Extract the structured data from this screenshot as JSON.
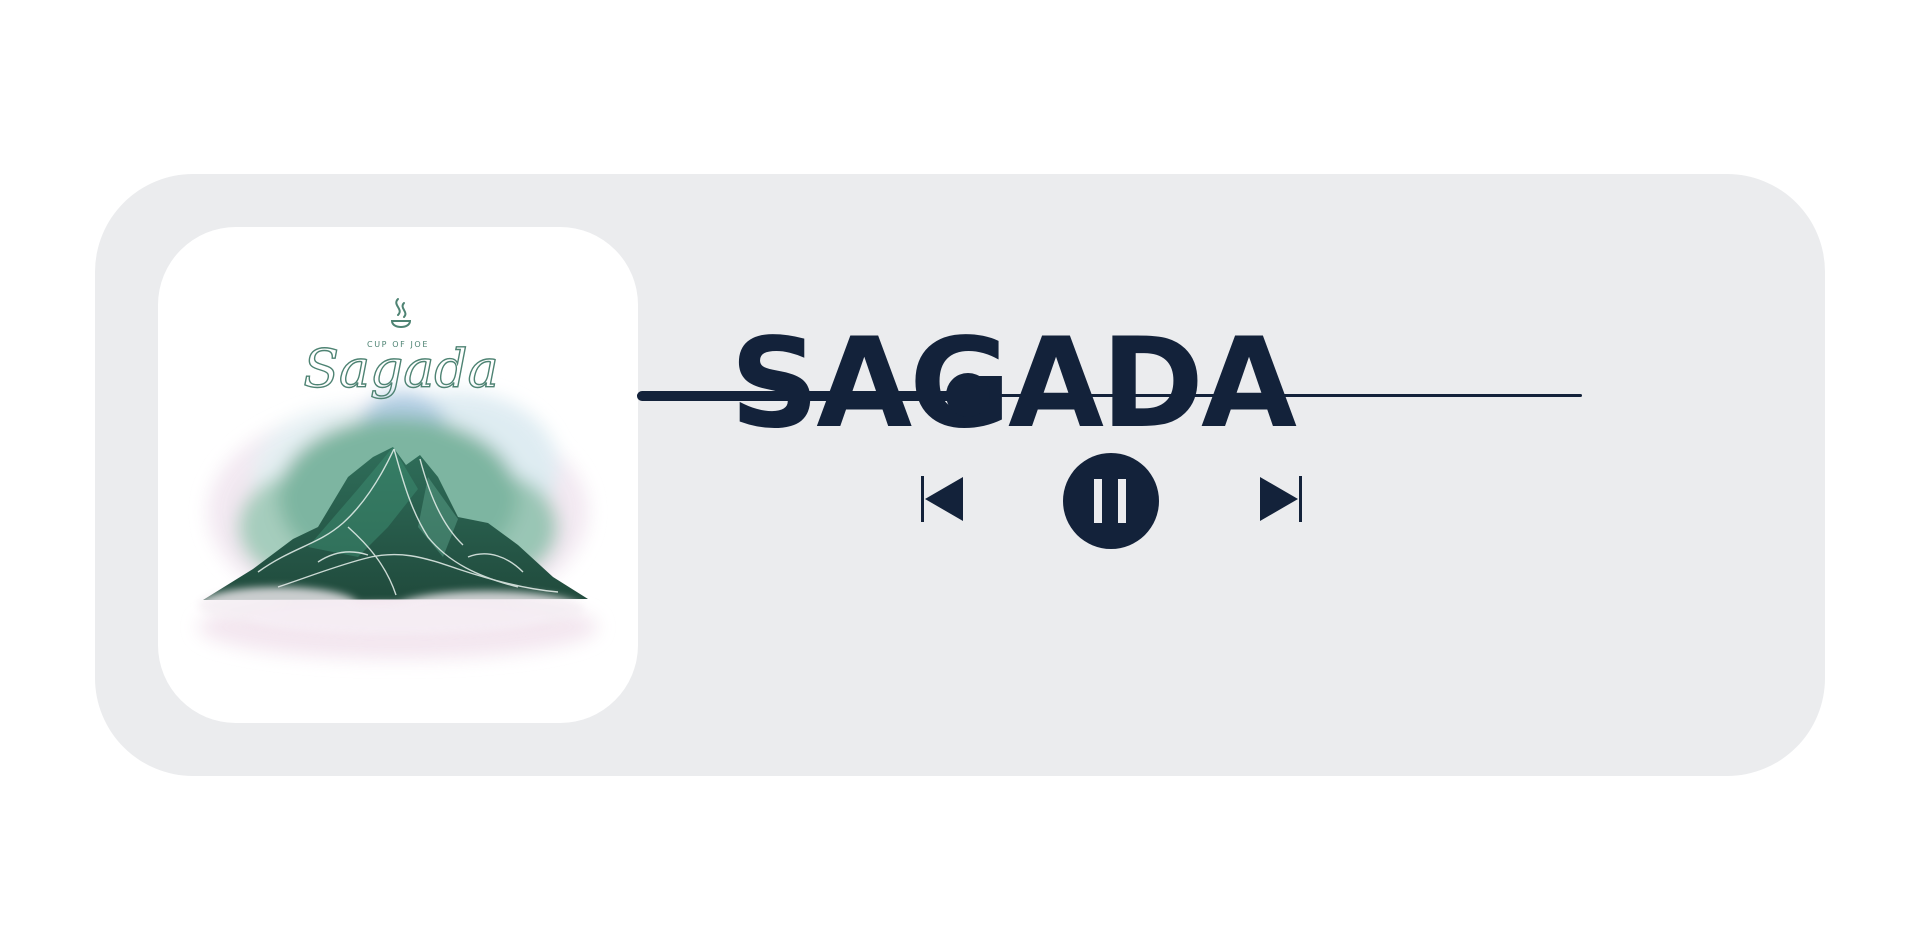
{
  "track": {
    "title": "SAGADA",
    "cover_label": "CUP OF JOE",
    "cover_script": "Sagada"
  },
  "playback": {
    "progress": 0.35,
    "state": "playing"
  },
  "controls": {
    "previous_icon": "skip-back-icon",
    "play_pause_icon": "pause-icon",
    "next_icon": "skip-forward-icon"
  },
  "colors": {
    "panel": "#ebecee",
    "ink": "#13223a",
    "cover_bg": "#ffffff",
    "mountain_green": "#2f6e5a",
    "cover_text": "#4e8373"
  }
}
